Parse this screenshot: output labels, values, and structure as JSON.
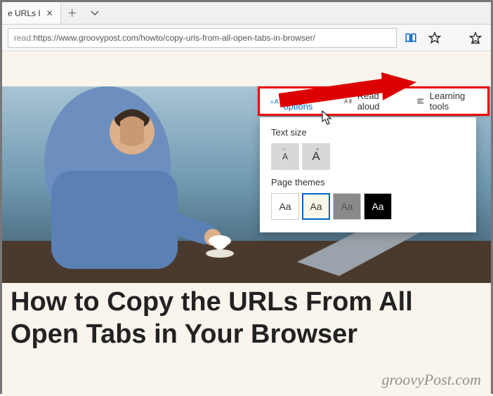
{
  "tab": {
    "title": "e URLs I"
  },
  "address": {
    "prefix": "read:",
    "url": "https://www.groovypost.com/howto/copy-urls-from-all-open-tabs-in-browser/"
  },
  "reading_toolbar": {
    "text_options": "Text options",
    "read_aloud": "Read aloud",
    "learning_tools": "Learning tools"
  },
  "options_panel": {
    "text_size_label": "Text size",
    "size_small": "A",
    "size_large": "A",
    "page_themes_label": "Page themes",
    "theme_sample": "Aa"
  },
  "article": {
    "title": "How to Copy the URLs From All Open Tabs in Your Browser"
  },
  "watermark": "groovyPost.com"
}
